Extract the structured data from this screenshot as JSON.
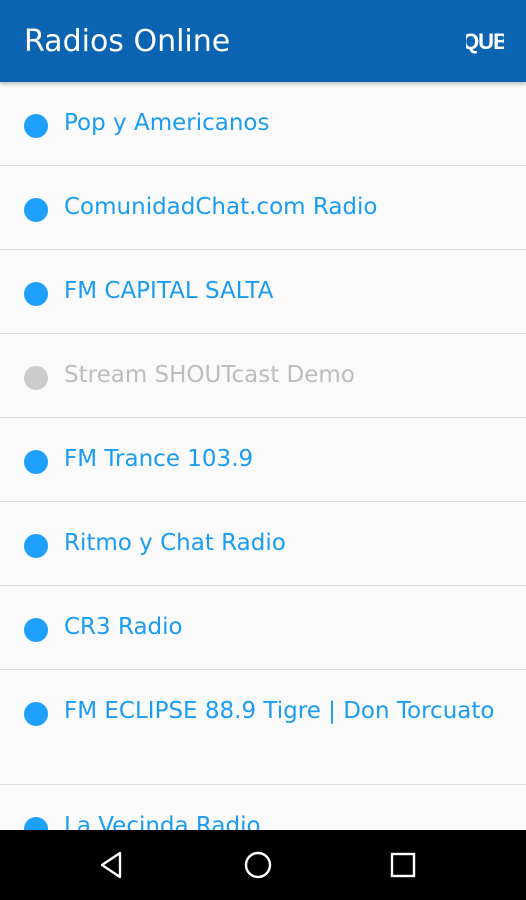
{
  "app": {
    "title": "Radios Online",
    "logo_text": "QUB",
    "accent_color": "#0a64b1"
  },
  "stations": [
    {
      "name": "Pop y Americanos",
      "status": "online"
    },
    {
      "name": "ComunidadChat.com Radio",
      "status": "online"
    },
    {
      "name": "FM CAPITAL SALTA",
      "status": "online"
    },
    {
      "name": "Stream SHOUTcast Demo",
      "status": "offline"
    },
    {
      "name": "FM Trance 103.9",
      "status": "online"
    },
    {
      "name": "Ritmo y Chat Radio",
      "status": "online"
    },
    {
      "name": "CR3 Radio",
      "status": "online"
    },
    {
      "name": "FM ECLIPSE 88.9 Tigre | Don Torcuato",
      "status": "online"
    },
    {
      "name": "La Vecinda Radio",
      "status": "online"
    }
  ],
  "status_colors": {
    "online": "#1ea0ff",
    "offline": "#cccccc"
  },
  "navbar": {
    "buttons": [
      "back-icon",
      "home-icon",
      "recents-icon"
    ]
  }
}
